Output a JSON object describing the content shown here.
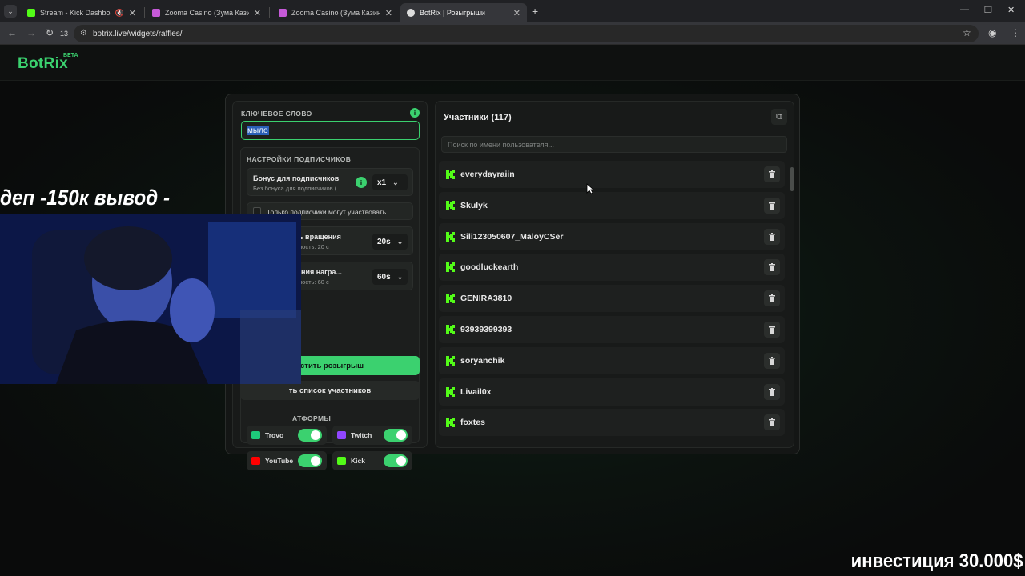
{
  "browser": {
    "tabs": [
      {
        "title": "Stream - Kick Dashboard",
        "favicon_color": "#53fc18",
        "active": false,
        "muted": true
      },
      {
        "title": "Zooma Casino (Зума Казино) о",
        "favicon_color": "#c65ad8",
        "active": false
      },
      {
        "title": "Zooma Casino (Зума Казино) о",
        "favicon_color": "#c65ad8",
        "active": false
      },
      {
        "title": "BotRix | Розыгрыши",
        "favicon_color": "#dddddd",
        "active": true
      }
    ],
    "reload_count": "13",
    "url": "botrix.live/widgets/raffles/"
  },
  "header": {
    "logo": "BotRix",
    "badge": "BETA"
  },
  "raffle": {
    "keyword_label": "КЛЮЧЕВОЕ СЛОВО",
    "keyword_value": "мыло",
    "subscribers_section": "НАСТРОЙКИ ПОДПИСЧИКОВ",
    "bonus_title": "Бонус для подписчиков",
    "bonus_sub": "Без бонуса для подписчиков (...",
    "bonus_value": "x1",
    "only_subs_label": "Только подписчики могут участвовать",
    "spin_title": "ь вращения",
    "spin_sub": "ность: 20 с",
    "spin_value": "20s",
    "reward_title": "ения награ...",
    "reward_sub": "ность: 60 с",
    "reward_value": "60s",
    "start_button": "устить розыгрыш",
    "clear_button": "ть список участников",
    "platforms_label": "АТФОРМЫ",
    "platforms": [
      {
        "name": "Trovo",
        "color": "#1ec97a",
        "enabled": true
      },
      {
        "name": "Twitch",
        "color": "#9146ff",
        "enabled": true
      },
      {
        "name": "YouTube",
        "color": "#ff0000",
        "enabled": true
      },
      {
        "name": "Kick",
        "color": "#53fc18",
        "enabled": true
      }
    ]
  },
  "participants": {
    "title": "Участники (117)",
    "search_placeholder": "Поиск по имени пользователя...",
    "list": [
      "everydayraiin",
      "Skulyk",
      "Sili123050607_MaloyCSer",
      "goodluckearth",
      "GENIRA3810",
      "93939399393",
      "soryanchik",
      "Livail0x",
      "foxtes"
    ]
  },
  "overlay": {
    "top_text": "деп -150к вывод -",
    "bottom_text": "инвестиция 30.000$"
  },
  "colors": {
    "accent": "#3bd16f",
    "kick": "#53fc18"
  }
}
